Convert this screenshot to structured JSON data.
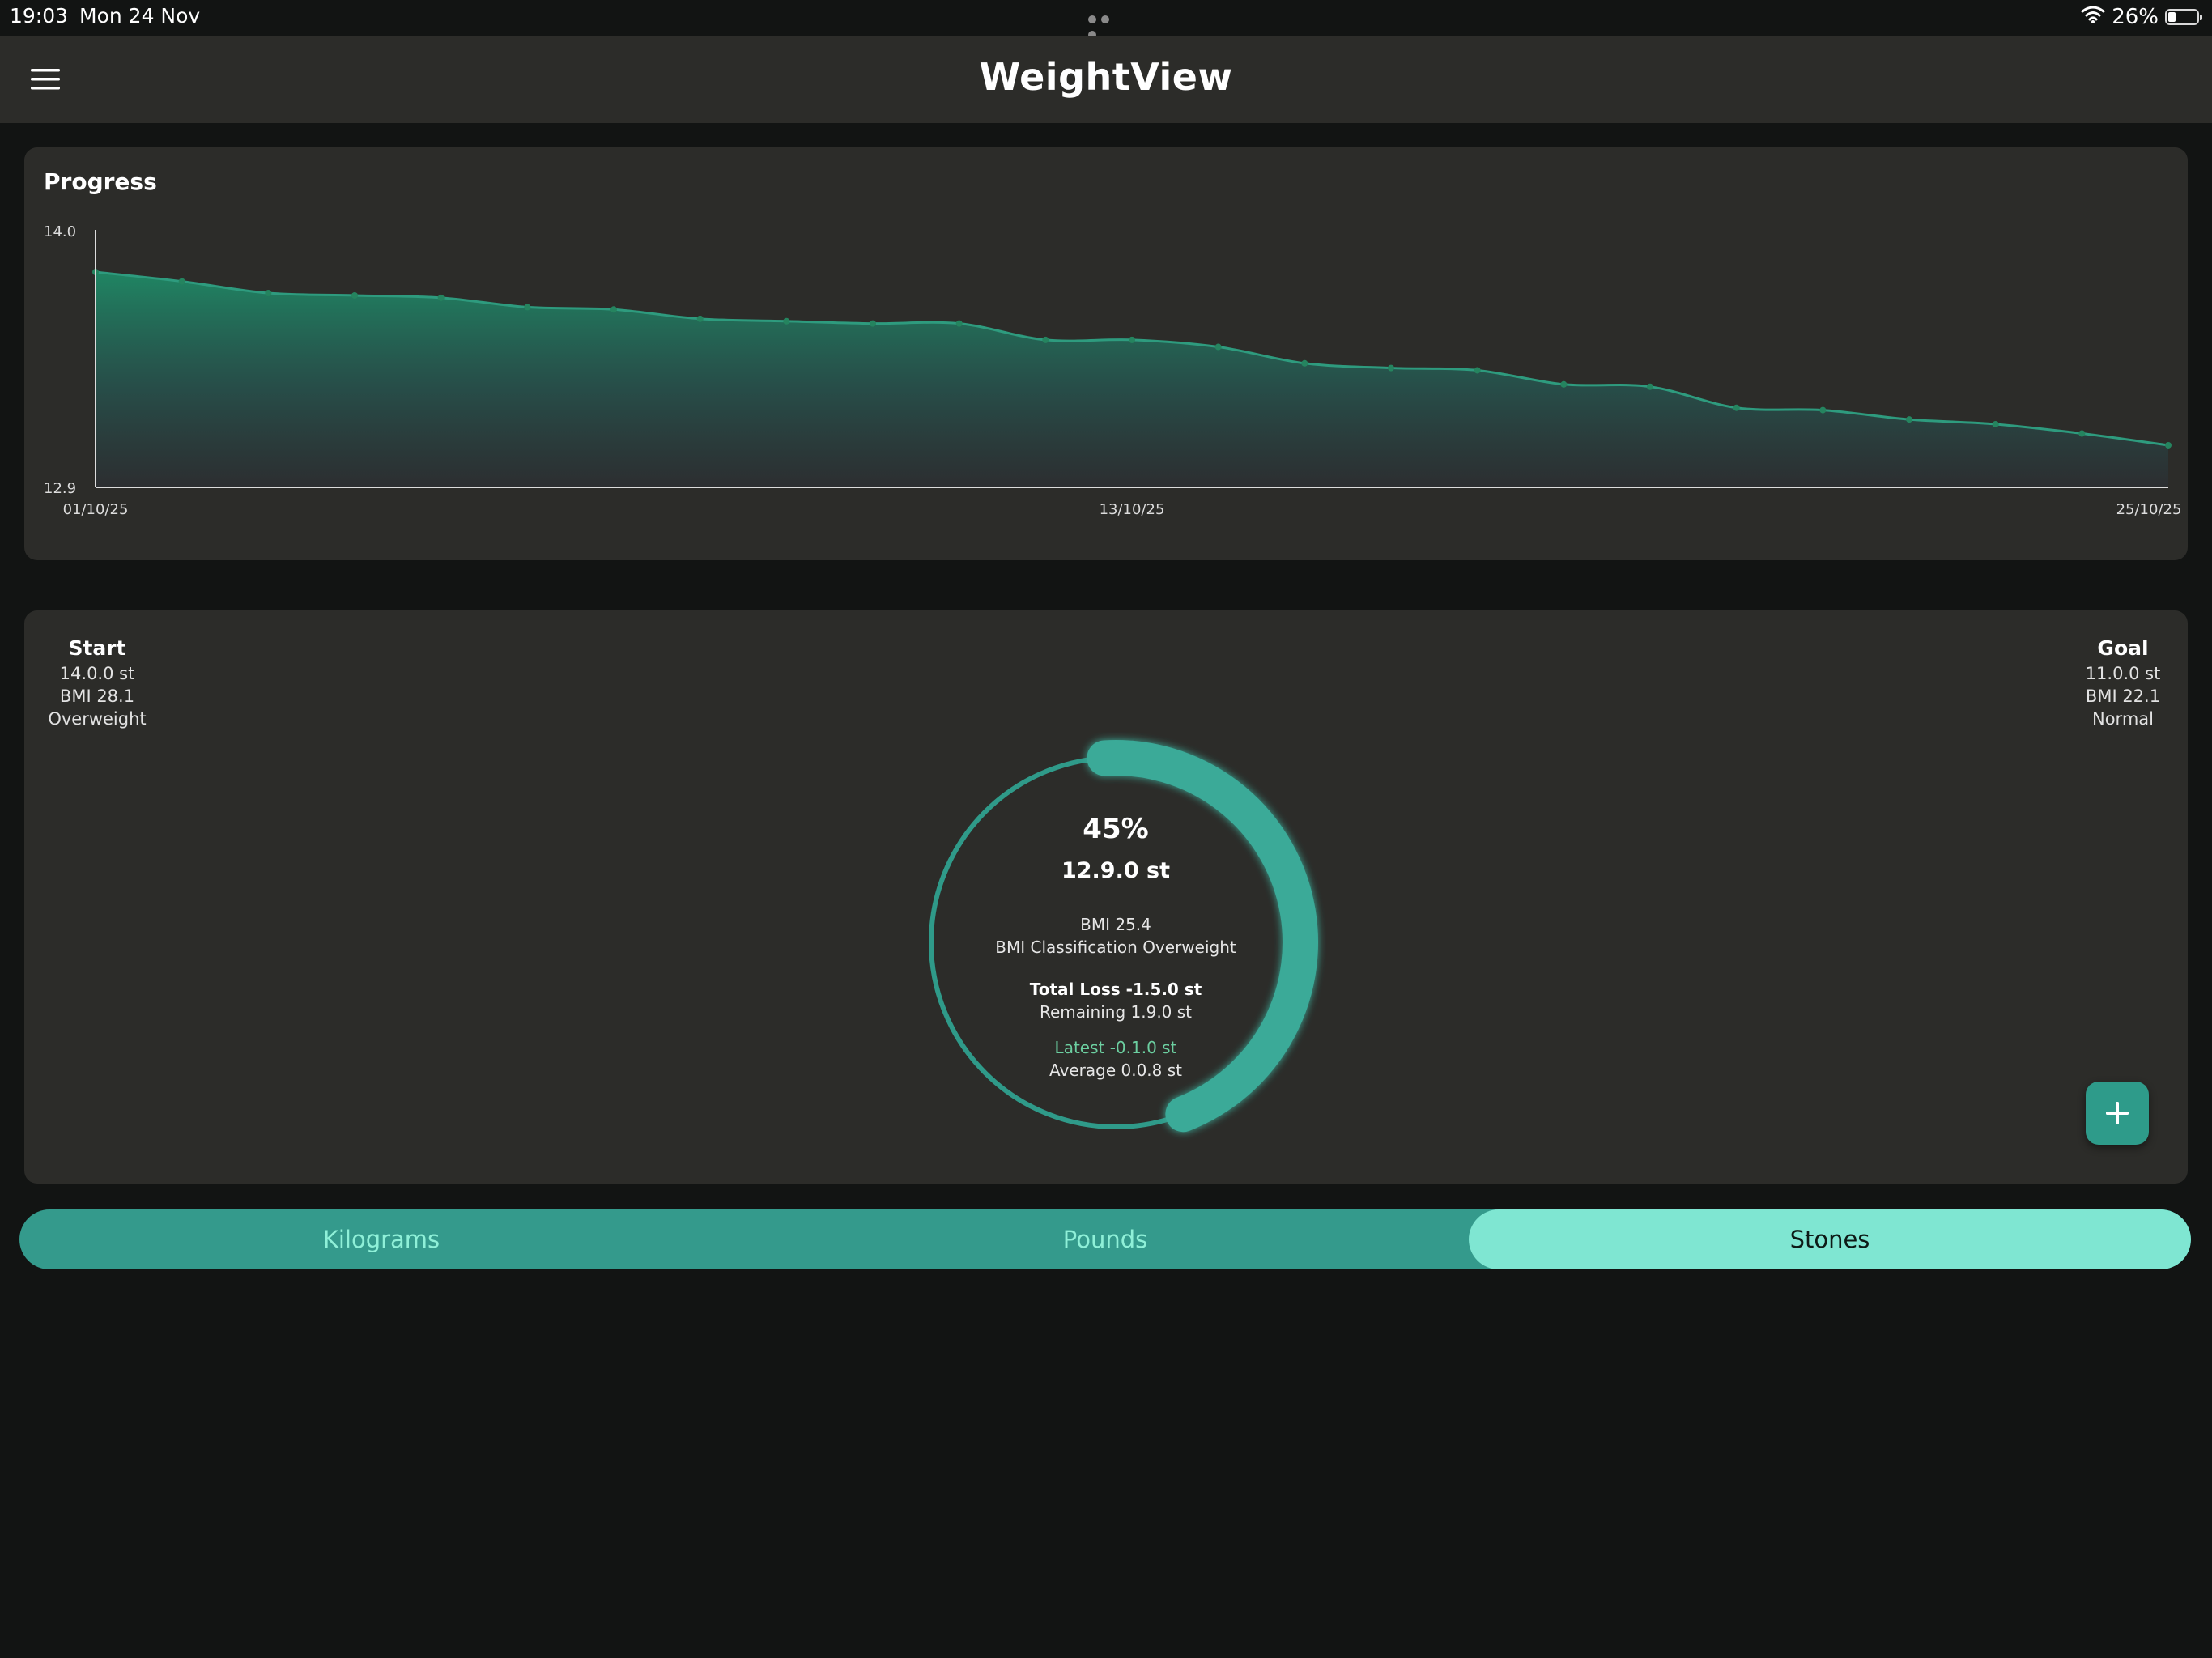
{
  "status_bar": {
    "time": "19:03",
    "date": "Mon 24 Nov",
    "battery": "26%",
    "battery_level": 0.26
  },
  "app_bar": {
    "title": "WeightView"
  },
  "progress_card": {
    "title": "Progress"
  },
  "chart_data": {
    "type": "area",
    "title": "",
    "xlabel": "",
    "ylabel": "",
    "x_ticks": [
      "01/10/25",
      "13/10/25",
      "25/10/25"
    ],
    "y_ticks": [
      "14.0",
      "12.9"
    ],
    "ylim": [
      12.9,
      14.0
    ],
    "grid": false,
    "x": [
      "01/10/25",
      "02/10/25",
      "03/10/25",
      "04/10/25",
      "05/10/25",
      "06/10/25",
      "07/10/25",
      "08/10/25",
      "09/10/25",
      "10/10/25",
      "11/10/25",
      "12/10/25",
      "13/10/25",
      "14/10/25",
      "15/10/25",
      "16/10/25",
      "17/10/25",
      "18/10/25",
      "19/10/25",
      "20/10/25",
      "21/10/25",
      "22/10/25",
      "23/10/25",
      "24/10/25",
      "25/10/25"
    ],
    "series": [
      {
        "values": [
          13.82,
          13.78,
          13.73,
          13.72,
          13.71,
          13.67,
          13.66,
          13.62,
          13.61,
          13.6,
          13.6,
          13.53,
          13.53,
          13.5,
          13.43,
          13.41,
          13.4,
          13.34,
          13.33,
          13.24,
          13.23,
          13.19,
          13.17,
          13.13,
          13.08
        ],
        "color": "#2e9b7e"
      }
    ]
  },
  "summary": {
    "start": {
      "label": "Start",
      "weight": "14.0.0 st",
      "bmi": "BMI 28.1",
      "classification": "Overweight"
    },
    "goal": {
      "label": "Goal",
      "weight": "11.0.0 st",
      "bmi": "BMI 22.1",
      "classification": "Normal"
    },
    "progress_fraction": 0.45,
    "percent": "45%",
    "current_weight": "12.9.0 st",
    "bmi": "BMI 25.4",
    "bmi_classification": "BMI Classification Overweight",
    "total_loss": "Total Loss -1.5.0 st",
    "remaining": "Remaining 1.9.0 st",
    "latest": "Latest -0.1.0 st",
    "average": "Average 0.0.8 st",
    "ring_color": "#3aaa98",
    "latest_color": "#6ccfa0"
  },
  "unit_selector": {
    "options": [
      "Kilograms",
      "Pounds",
      "Stones"
    ],
    "selected": "Stones"
  }
}
